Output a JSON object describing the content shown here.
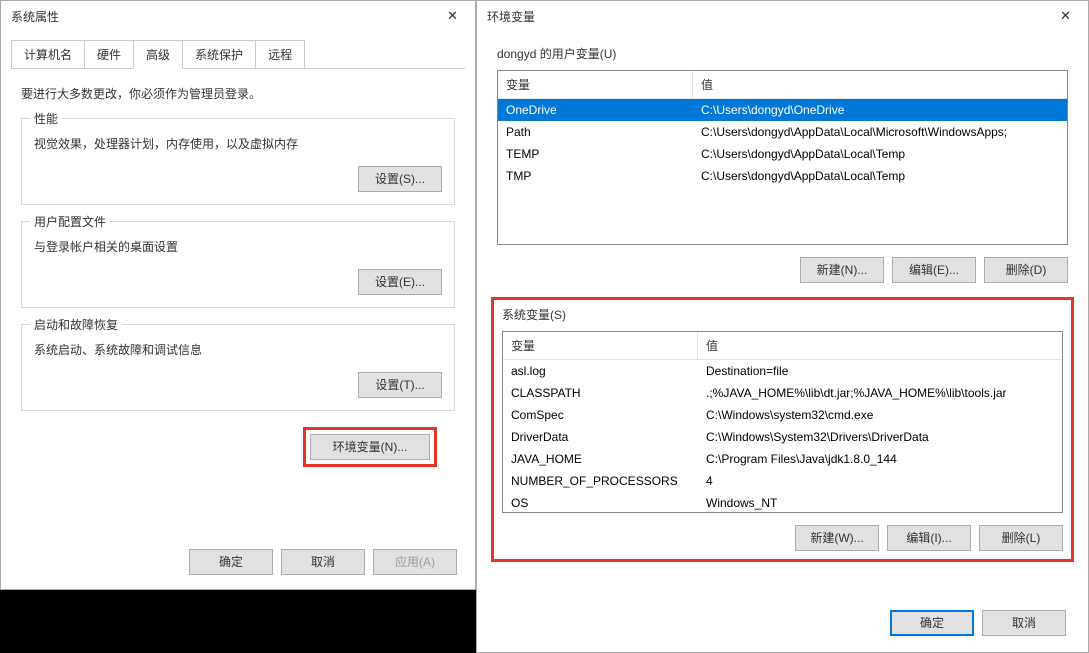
{
  "left": {
    "title": "系统属性",
    "tabs": [
      "计算机名",
      "硬件",
      "高级",
      "系统保护",
      "远程"
    ],
    "activeTab": 2,
    "notice": "要进行大多数更改，你必须作为管理员登录。",
    "perf": {
      "legend": "性能",
      "text": "视觉效果，处理器计划，内存使用，以及虚拟内存",
      "btn": "设置(S)..."
    },
    "profile": {
      "legend": "用户配置文件",
      "text": "与登录帐户相关的桌面设置",
      "btn": "设置(E)..."
    },
    "startup": {
      "legend": "启动和故障恢复",
      "text": "系统启动、系统故障和调试信息",
      "btn": "设置(T)..."
    },
    "envBtn": "环境变量(N)...",
    "ok": "确定",
    "cancel": "取消",
    "apply": "应用(A)"
  },
  "right": {
    "title": "环境变量",
    "user": {
      "label": "dongyd 的用户变量(U)",
      "cols": [
        "变量",
        "值"
      ],
      "rows": [
        {
          "var": "OneDrive",
          "val": "C:\\Users\\dongyd\\OneDrive",
          "sel": true
        },
        {
          "var": "Path",
          "val": "C:\\Users\\dongyd\\AppData\\Local\\Microsoft\\WindowsApps;"
        },
        {
          "var": "TEMP",
          "val": "C:\\Users\\dongyd\\AppData\\Local\\Temp"
        },
        {
          "var": "TMP",
          "val": "C:\\Users\\dongyd\\AppData\\Local\\Temp"
        }
      ],
      "new": "新建(N)...",
      "edit": "编辑(E)...",
      "del": "删除(D)"
    },
    "sys": {
      "label": "系统变量(S)",
      "cols": [
        "变量",
        "值"
      ],
      "rows": [
        {
          "var": "asl.log",
          "val": "Destination=file"
        },
        {
          "var": "CLASSPATH",
          "val": ".;%JAVA_HOME%\\lib\\dt.jar;%JAVA_HOME%\\lib\\tools.jar"
        },
        {
          "var": "ComSpec",
          "val": "C:\\Windows\\system32\\cmd.exe"
        },
        {
          "var": "DriverData",
          "val": "C:\\Windows\\System32\\Drivers\\DriverData"
        },
        {
          "var": "JAVA_HOME",
          "val": "C:\\Program Files\\Java\\jdk1.8.0_144"
        },
        {
          "var": "NUMBER_OF_PROCESSORS",
          "val": "4"
        },
        {
          "var": "OS",
          "val": "Windows_NT"
        }
      ],
      "new": "新建(W)...",
      "edit": "编辑(I)...",
      "del": "删除(L)"
    },
    "ok": "确定",
    "cancel": "取消"
  }
}
